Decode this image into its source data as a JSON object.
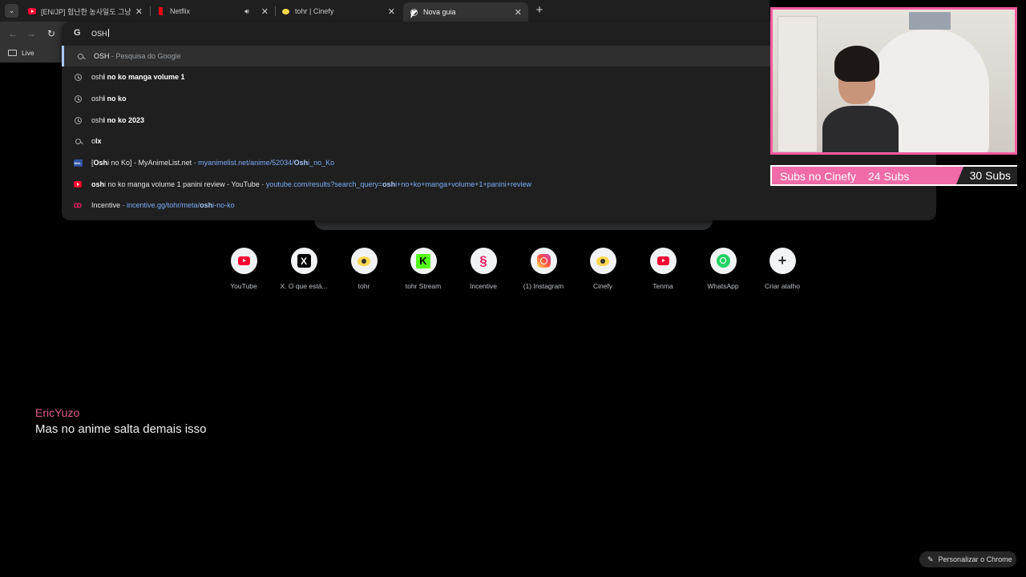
{
  "tabs": [
    {
      "title": "[EN/JP] 험난한 농사일도 그냥 재",
      "favicon": "youtube-icon",
      "active": false
    },
    {
      "title": "Netflix",
      "favicon": "netflix-icon",
      "active": false,
      "audio": true
    },
    {
      "title": "tohr | Cinefy",
      "favicon": "cinefy-icon",
      "active": false
    },
    {
      "title": "Nova guia",
      "favicon": "newtab-icon",
      "active": true
    }
  ],
  "bookmarks": [
    {
      "label": "Live"
    }
  ],
  "omnibox": {
    "value": "OSH",
    "suggestions": [
      {
        "icon": "search-icon",
        "bold": "OSH",
        "text": "",
        "sep": " - ",
        "desc": "Pesquisa do Google",
        "url": ""
      },
      {
        "icon": "history-icon",
        "pre": "osh",
        "bold": "i no ko manga volume 1"
      },
      {
        "icon": "history-icon",
        "pre": "osh",
        "bold": "i no ko"
      },
      {
        "icon": "history-icon",
        "pre": "osh",
        "bold": "i no ko 2023"
      },
      {
        "icon": "search-icon",
        "pre": "o",
        "bold": "lx"
      },
      {
        "icon": "mal-icon",
        "title_pre": "[",
        "title_bold": "Osh",
        "title_post": "i no Ko] - MyAnimeList.net",
        "sep": " - ",
        "url_pre": "myanimelist.net/anime/52034/",
        "url_bold": "Osh",
        "url_post": "i_no_Ko"
      },
      {
        "icon": "youtube-icon",
        "title_pre": "",
        "title_bold": "osh",
        "title_post": "i no ko manga volume 1 panini review - YouTube",
        "sep": " - ",
        "url_pre": "youtube.com/results?search_query=",
        "url_bold": "osh",
        "url_post": "i+no+ko+manga+volume+1+panini+review"
      },
      {
        "icon": "incentive-icon",
        "title_pre": "Incentive",
        "title_bold": "",
        "title_post": "",
        "sep": " - ",
        "url_pre": "incentive.gg/tohr/meta/",
        "url_bold": "osh",
        "url_post": "i-no-ko"
      }
    ]
  },
  "shortcuts": [
    {
      "label": "YouTube",
      "icon": "youtube-icon"
    },
    {
      "label": "X. O que está...",
      "icon": "x-icon"
    },
    {
      "label": "tohr",
      "icon": "cinefy-icon"
    },
    {
      "label": "tohr Stream",
      "icon": "kick-icon"
    },
    {
      "label": "Incentive",
      "icon": "incentive-icon"
    },
    {
      "label": "(1) Instagram",
      "icon": "instagram-icon"
    },
    {
      "label": "Cinefy",
      "icon": "cinefy-icon"
    },
    {
      "label": "Tenma",
      "icon": "youtube-icon"
    },
    {
      "label": "WhatsApp",
      "icon": "whatsapp-icon"
    },
    {
      "label": "Criar atalho",
      "icon": "plus-icon"
    }
  ],
  "overlay": {
    "subs_label": "Subs no Cinefy",
    "subs_current": "24 Subs",
    "subs_goal": "30 Subs"
  },
  "chat": {
    "user": "EricYuzo",
    "message": "Mas no anime salta demais isso"
  },
  "customize_label": "Personalizar o Chrome",
  "colors": {
    "accent_pink": "#f06ba8",
    "webcam_border": "#ff5c9f",
    "link_blue": "#7cacf8"
  }
}
